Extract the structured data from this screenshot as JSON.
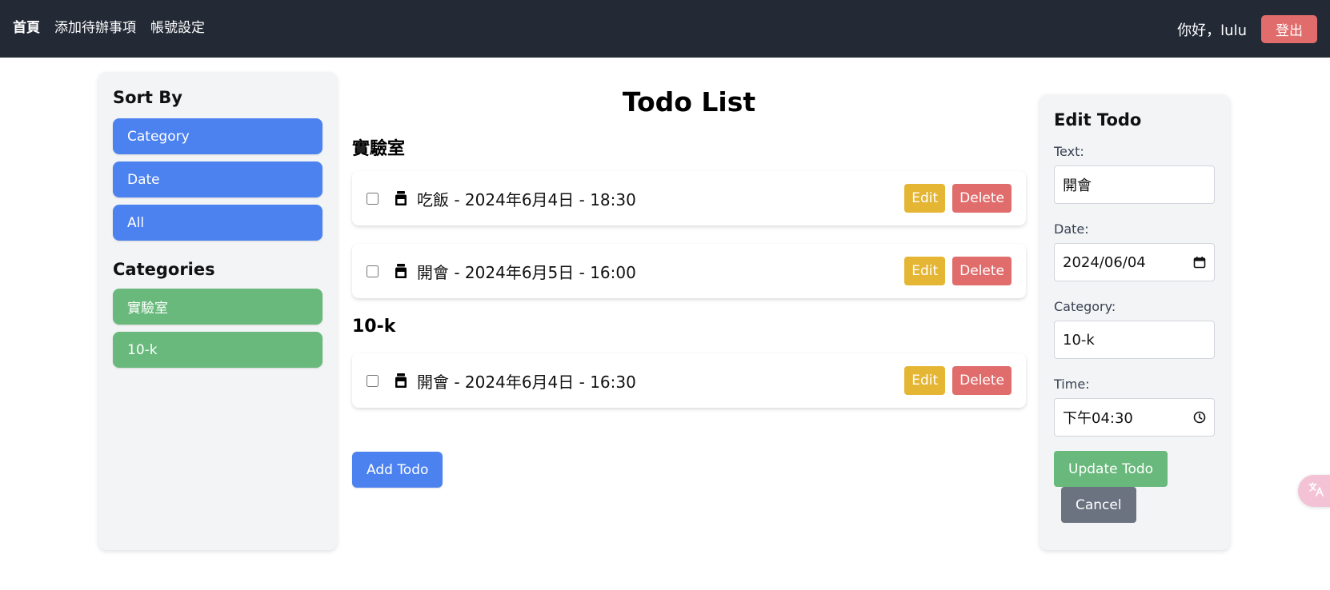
{
  "nav": {
    "links": [
      {
        "label": "首頁"
      },
      {
        "label": "添加待辦事項"
      },
      {
        "label": "帳號設定"
      }
    ],
    "greeting": "你好，lulu",
    "logout_label": "登出"
  },
  "sidebar": {
    "sort_heading": "Sort By",
    "sort_options": [
      {
        "label": "Category"
      },
      {
        "label": "Date"
      },
      {
        "label": "All"
      }
    ],
    "categories_heading": "Categories",
    "categories": [
      {
        "label": "實驗室"
      },
      {
        "label": "10-k"
      }
    ]
  },
  "main": {
    "title": "Todo List",
    "groups": [
      {
        "name": "實驗室",
        "todos": [
          {
            "text": "吃飯 - 2024年6月4日 - 18:30",
            "checked": false
          },
          {
            "text": "開會 - 2024年6月5日 - 16:00",
            "checked": false
          }
        ]
      },
      {
        "name": "10-k",
        "todos": [
          {
            "text": "開會 - 2024年6月4日 - 16:30",
            "checked": false
          }
        ]
      }
    ],
    "edit_label": "Edit",
    "delete_label": "Delete",
    "add_label": "Add Todo"
  },
  "edit_panel": {
    "heading": "Edit Todo",
    "text_label": "Text:",
    "text_value": "開會",
    "date_label": "Date:",
    "date_value": "2024/06/04",
    "category_label": "Category:",
    "category_value": "10-k",
    "time_label": "Time:",
    "time_value": "下午04:30",
    "update_label": "Update Todo",
    "cancel_label": "Cancel"
  },
  "icons": {
    "todo": "jar-icon",
    "calendar": "calendar-icon",
    "clock": "clock-icon",
    "translate": "translate-icon"
  },
  "colors": {
    "navbar": "#232a36",
    "primary": "#4c82f0",
    "success": "#68b97b",
    "warning": "#e5b534",
    "danger": "#e06c6c",
    "secondary": "#6b7280"
  }
}
